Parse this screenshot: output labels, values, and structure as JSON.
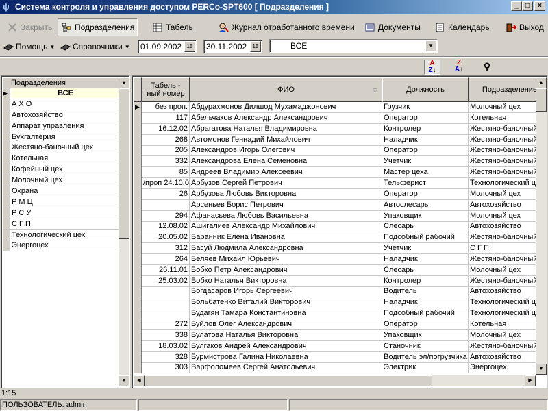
{
  "window": {
    "title": "Система контроля и управления доступом PERCo-SPT600 [ Подразделения ]",
    "min": "_",
    "max": "□",
    "close": "×"
  },
  "toolbar": {
    "close": "Закрыть",
    "departments": "Подразделения",
    "tabel": "Табель",
    "journal": "Журнал отработанного времени",
    "documents": "Документы",
    "calendar": "Календарь",
    "exit": "Выход",
    "help": "Помощь",
    "references": "Справочники"
  },
  "filter": {
    "date_from": "01.09.2002",
    "date_to": "30.11.2002",
    "department": "ВСЕ"
  },
  "departments": {
    "header": "Подразделения",
    "items": [
      "ВСЕ",
      "А Х О",
      "Автохозяйство",
      "Аппарат управления",
      "Бухгалтерия",
      "Жестяно-баночный цех",
      "Котельная",
      "Кофейный цех",
      "Молочный цех",
      "Охрана",
      "Р М Ц",
      "Р С У",
      "С Г П",
      "Технологический цех",
      "Энергоцех"
    ]
  },
  "grid": {
    "columns": [
      "Табель - ный номер",
      "ФИО",
      "Должность",
      "Подразделение"
    ],
    "rows": [
      [
        "без проп.",
        "Абдурахмонов Дилшод Мухамаджонович",
        "Грузчик",
        "Молочный цех"
      ],
      [
        "117",
        "Абельчаков Александр Александрович",
        "Оператор",
        "Котельная"
      ],
      [
        "16.12.02",
        "Абрагатова Наталья Владимировна",
        "Контролер",
        "Жестяно-баночный"
      ],
      [
        "268",
        "Автомонов Геннадий Михайлович",
        "Наладчик",
        "Жестяно-баночный"
      ],
      [
        "205",
        "Александров Игорь Олегович",
        "Оператор",
        "Жестяно-баночный"
      ],
      [
        "332",
        "Александрова Елена Семеновна",
        "Учетчик",
        "Жестяно-баночный"
      ],
      [
        "85",
        "Андреев Владимир Алексеевич",
        "Мастер цеха",
        "Жестяно-баночный"
      ],
      [
        "/проп 24.10.0",
        "Арбузов Сергей Петрович",
        "Тельферист",
        "Технологический ц"
      ],
      [
        "26",
        "Арбузова Любовь Викторовна",
        "Оператор",
        "Молочный цех"
      ],
      [
        "",
        "Арсеньев Борис Петрович",
        "Автослесарь",
        "Автохозяйство"
      ],
      [
        "294",
        "Афанасьева Любовь Васильевна",
        "Упаковщик",
        "Молочный цех"
      ],
      [
        "12.08.02",
        "Ашигалиев Александр Михайлович",
        "Слесарь",
        "Автохозяйство"
      ],
      [
        "20.05.02",
        "Баранник Елена Ивановна",
        "Подсобный рабочий",
        "Жестяно-баночный"
      ],
      [
        "312",
        "Басуй Людмила Александровна",
        "Учетчик",
        "С Г П"
      ],
      [
        "264",
        "Беляев Михаил Юрьевич",
        "Наладчик",
        "Жестяно-баночный"
      ],
      [
        "26.11.01",
        "Бобко Петр Александрович",
        "Слесарь",
        "Молочный цех"
      ],
      [
        "25.03.02",
        "Бобко Наталья Викторовна",
        "Контролер",
        "Жестяно-баночный"
      ],
      [
        "",
        "Богдасаров Игорь Сергеевич",
        "Водитель",
        "Автохозяйство"
      ],
      [
        "",
        "Больбатенко Виталий Викторович",
        "Наладчик",
        "Технологический ц"
      ],
      [
        "",
        "Будагян Тамара Константиновна",
        "Подсобный рабочий",
        "Технологический ц"
      ],
      [
        "272",
        "Буйлов Олег Александрович",
        "Оператор",
        "Котельная"
      ],
      [
        "338",
        "Булатова Наталья Викторовна",
        "Упаковщик",
        "Молочный цех"
      ],
      [
        "18.03.02",
        "Булгаков Андрей Александрович",
        "Станочник",
        "Жестяно-баночный"
      ],
      [
        "328",
        "Бурмистрова Галина Николаевна",
        "Водитель эл/погрузчика",
        "Автохозяйство"
      ],
      [
        "303",
        "Варфоломеев Сергей Анатольевич",
        "Электрик",
        "Энергоцех"
      ]
    ]
  },
  "status": {
    "position": "1:15",
    "user": "ПОЛЬЗОВАТЕЛЬ: admin"
  }
}
